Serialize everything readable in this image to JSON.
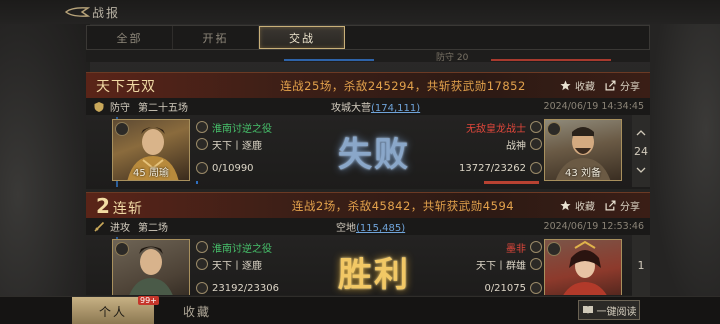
{
  "header": {
    "title": "战报"
  },
  "tabs": [
    {
      "label": "全部",
      "active": false
    },
    {
      "label": "开拓",
      "active": false
    },
    {
      "label": "交战",
      "active": true
    }
  ],
  "strip_text": "防守 20",
  "reports": [
    {
      "title": "天下无双",
      "summary": "连战25场，杀敌245294，共斩获武勋17852",
      "favorite_label": "收藏",
      "share_label": "分享",
      "type": "防守",
      "round": "第二十五场",
      "place": "攻城大营",
      "coord": "(174,111)",
      "time": "2024/06/19 14:34:45",
      "result": "失败",
      "left": {
        "level_name": "45 周瑜",
        "battle": "淮南讨逆之役",
        "faction": "天下丨逐鹿",
        "troops": "0/10990",
        "troop_fraction": 0.0
      },
      "right": {
        "level_name": "43 刘备",
        "name": "无敌皇龙战士",
        "title": "战神",
        "troops": "13727/23262",
        "troop_fraction": 0.59
      },
      "side_count": "24"
    },
    {
      "title_num": "2",
      "title": "连斩",
      "summary": "连战2场，杀敌45842，共斩获武勋4594",
      "favorite_label": "收藏",
      "share_label": "分享",
      "type": "进攻",
      "round": "第二场",
      "place": "空地",
      "coord": "(115,485)",
      "time": "2024/06/19 12:53:46",
      "result": "胜利",
      "left": {
        "battle": "淮南讨逆之役",
        "faction": "天下丨逐鹿",
        "troops": "23192/23306",
        "troop_fraction": 0.99
      },
      "right": {
        "name": "墨非",
        "faction": "天下丨群雄",
        "troops": "0/21075",
        "troop_fraction": 0.0
      },
      "side_count": "1"
    }
  ],
  "bottom": {
    "tab_personal": "个人",
    "tab_favorites": "收藏",
    "notif": "99+",
    "read_all": "一键阅读"
  },
  "colors": {
    "accent_gold": "#c9b079",
    "win": "#f2c865",
    "lose": "#8aa7c9",
    "green": "#47c26b",
    "red": "#e0473b"
  }
}
